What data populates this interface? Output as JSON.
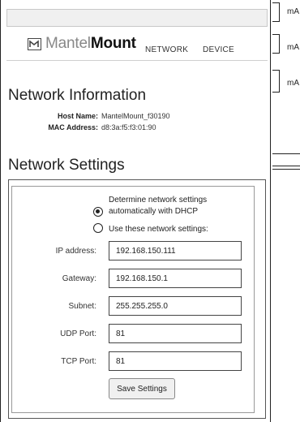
{
  "header": {
    "logo": {
      "part1": "Mantel",
      "part2": "Mount"
    },
    "nav": {
      "network": "NETWORK",
      "device": "DEVICE"
    }
  },
  "network_info": {
    "heading": "Network Information",
    "host_name_label": "Host Name:",
    "host_name_value": "MantelMount_f30190",
    "mac_label": "MAC Address:",
    "mac_value": "d8:3a:f5:f3:01:90"
  },
  "network_settings": {
    "heading": "Network Settings",
    "options": {
      "dhcp_line1": "Determine network settings",
      "dhcp_line2": "automatically with DHCP",
      "dhcp_selected": true,
      "static": "Use these network settings:",
      "static_selected": false
    },
    "fields": {
      "ip": {
        "label": "IP address:",
        "value": "192.168.150.111"
      },
      "gateway": {
        "label": "Gateway:",
        "value": "192.168.150.1"
      },
      "subnet": {
        "label": "Subnet:",
        "value": "255.255.255.0"
      },
      "udp": {
        "label": "UDP Port:",
        "value": "81"
      },
      "tcp": {
        "label": "TCP Port:",
        "value": "81"
      }
    },
    "save_label": "Save Settings"
  },
  "side_labels": [
    "mA",
    "mA",
    "mA"
  ]
}
